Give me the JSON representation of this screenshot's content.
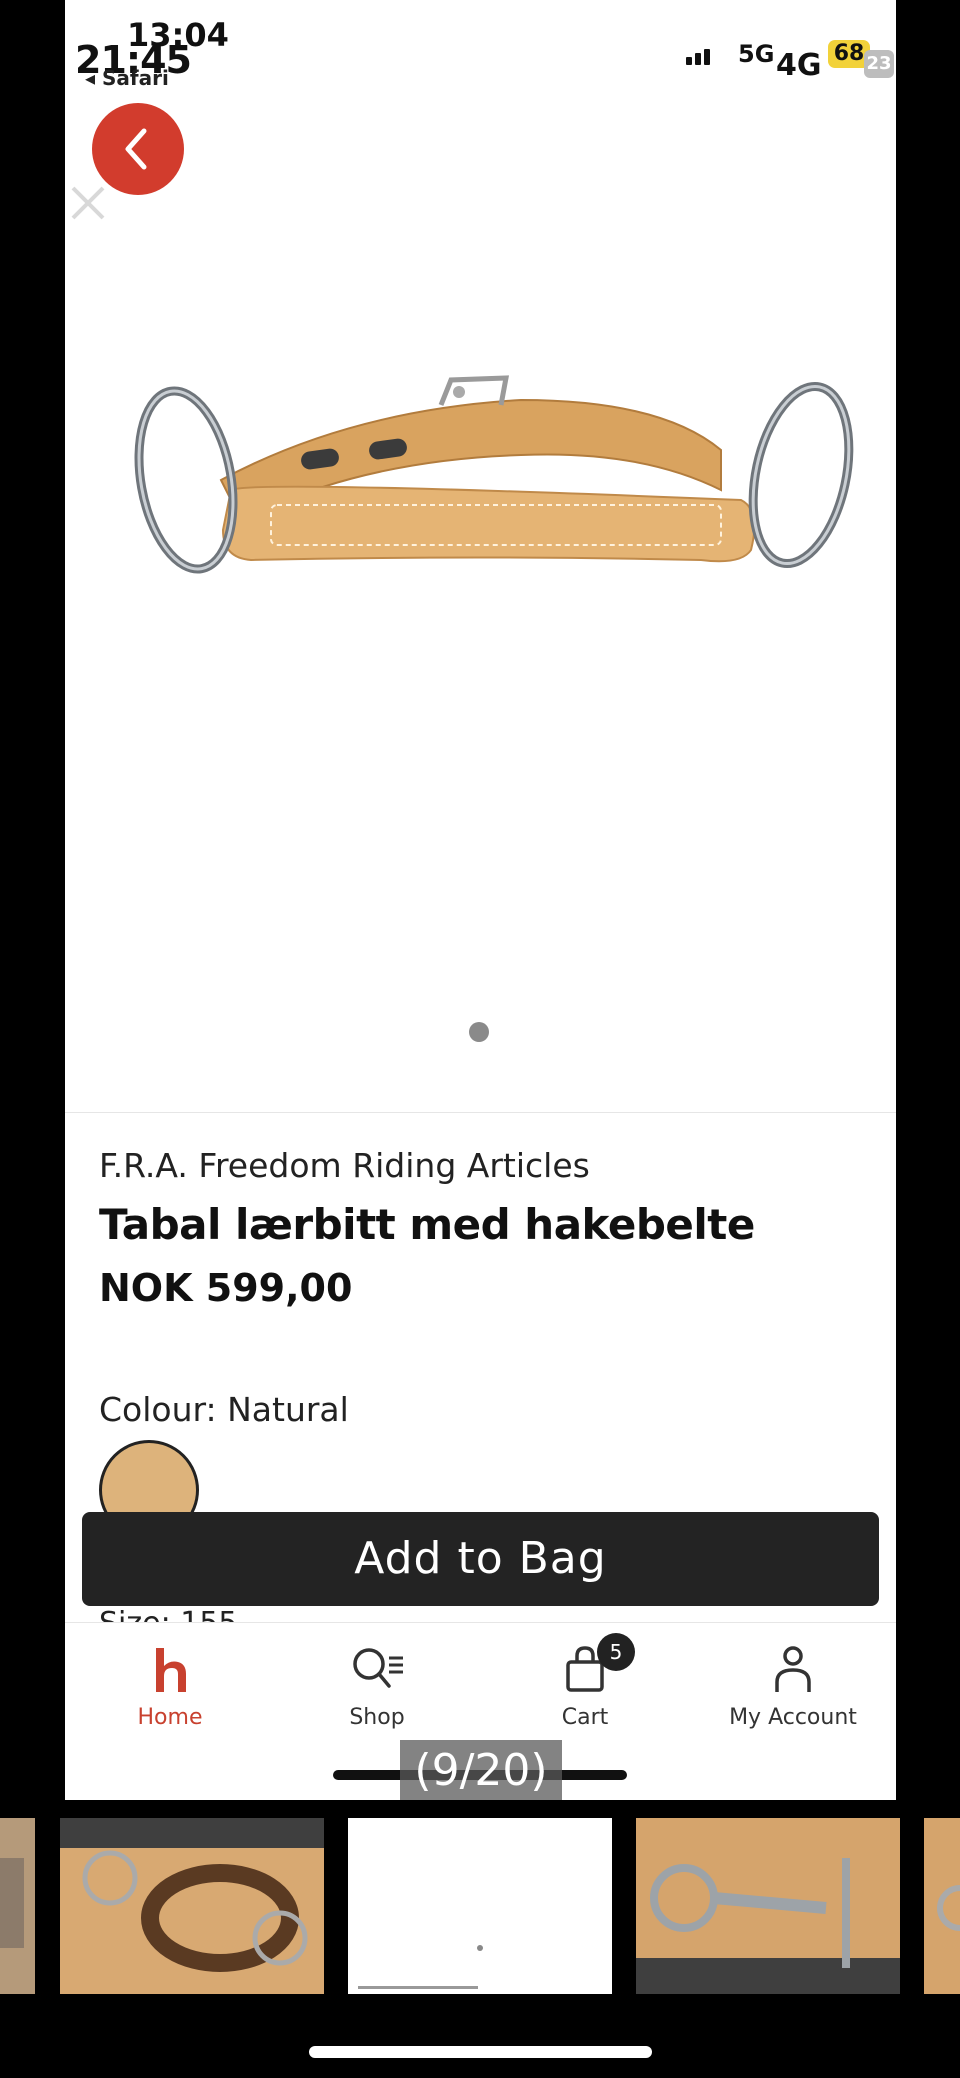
{
  "status_bar": {
    "time_primary": "21:45",
    "time_secondary": "13:04",
    "back_app": "◂ Safari",
    "network_a": "5G",
    "network_b": "4G",
    "battery_a": "68",
    "battery_b": "23"
  },
  "product": {
    "brand": "F.R.A. Freedom Riding Articles",
    "title": "Tabal lærbitt med hakebelte",
    "price": "NOK 599,00",
    "colour_label": "Colour: Natural",
    "colour_hex": "#ddb37b",
    "size_peek": "Size: 155",
    "image_count": 1
  },
  "actions": {
    "add_to_bag": "Add to Bag"
  },
  "tabbar": {
    "items": [
      {
        "label": "Home",
        "icon": "home-logo-icon",
        "active": true
      },
      {
        "label": "Shop",
        "icon": "search-list-icon",
        "active": false
      },
      {
        "label": "Cart",
        "icon": "bag-icon",
        "active": false,
        "badge": "5"
      },
      {
        "label": "My Account",
        "icon": "person-icon",
        "active": false
      }
    ]
  },
  "viewer": {
    "counter": "(9/20)"
  },
  "colors": {
    "accent": "#c8412f",
    "back_button": "#d23c2d",
    "button_dark": "#232323"
  }
}
